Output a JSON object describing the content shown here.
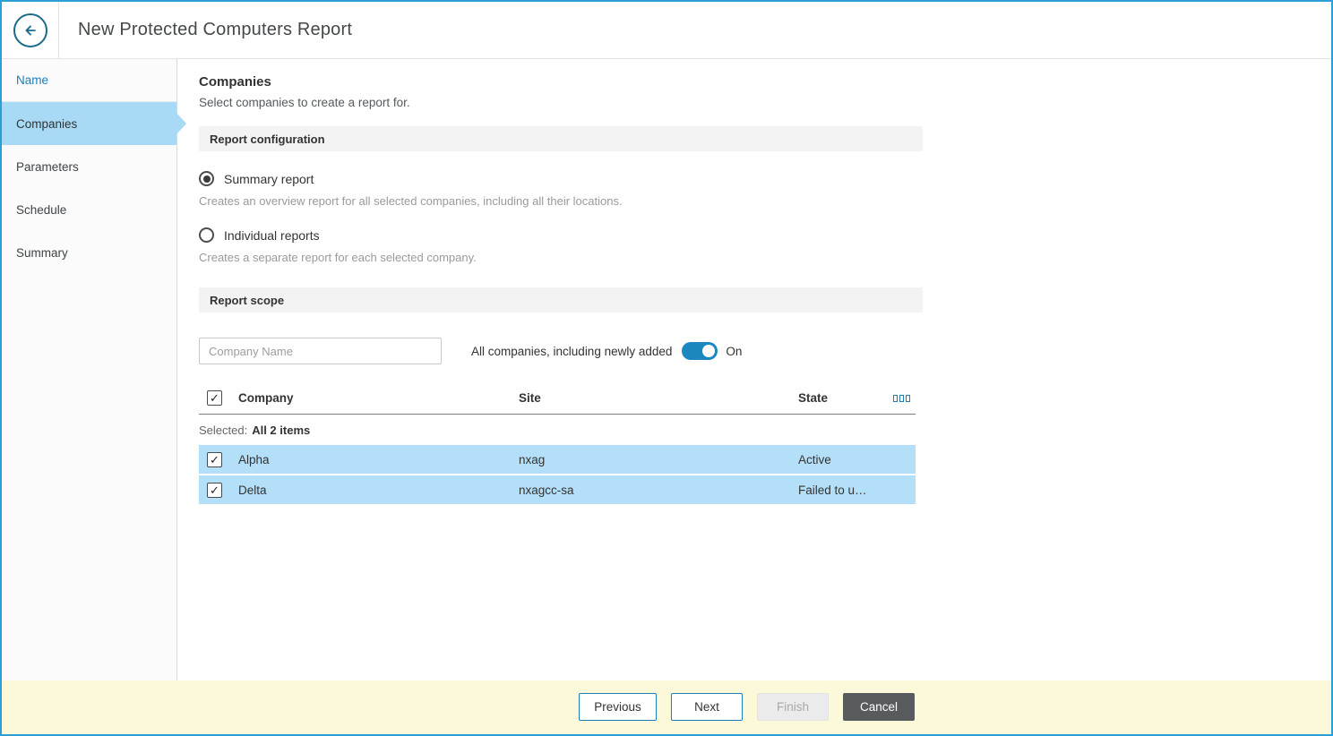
{
  "window": {
    "title": "New Protected Computers Report"
  },
  "sidebar": {
    "items": [
      {
        "label": "Name",
        "state": "done"
      },
      {
        "label": "Companies",
        "state": "active"
      },
      {
        "label": "Parameters",
        "state": "upcoming"
      },
      {
        "label": "Schedule",
        "state": "upcoming"
      },
      {
        "label": "Summary",
        "state": "upcoming"
      }
    ]
  },
  "main": {
    "heading": "Companies",
    "subheading": "Select companies to create a report for.",
    "report_configuration": {
      "section_title": "Report configuration",
      "options": [
        {
          "label": "Summary report",
          "description": "Creates an overview report for all selected companies, including all their locations.",
          "selected": true
        },
        {
          "label": "Individual reports",
          "description": "Creates a separate report for each selected company.",
          "selected": false
        }
      ]
    },
    "report_scope": {
      "section_title": "Report scope",
      "search_placeholder": "Company Name",
      "toggle_label": "All companies, including newly added",
      "toggle_state": "On",
      "table": {
        "columns": [
          "Company",
          "Site",
          "State"
        ],
        "selected_text": "Selected:",
        "selected_value": "All 2 items",
        "rows": [
          {
            "company": "Alpha",
            "site": "nxag",
            "state": "Active",
            "checked": true
          },
          {
            "company": "Delta",
            "site": "nxagcc-sa",
            "state": "Failed to u…",
            "checked": true
          }
        ]
      }
    }
  },
  "footer": {
    "previous_label": "Previous",
    "next_label": "Next",
    "finish_label": "Finish",
    "cancel_label": "Cancel"
  },
  "icons": {
    "back": "back-arrow-icon",
    "columns": "column-chooser-icon"
  },
  "colors": {
    "accent_blue": "#1d7fb5",
    "outer_border": "#2b9fd6",
    "active_step_bg": "#a8daf5",
    "row_highlight": "#b3dff8",
    "toggle_on": "#1b87be",
    "footer_bg": "#fcf8da",
    "cancel_bg": "#575b5e"
  }
}
